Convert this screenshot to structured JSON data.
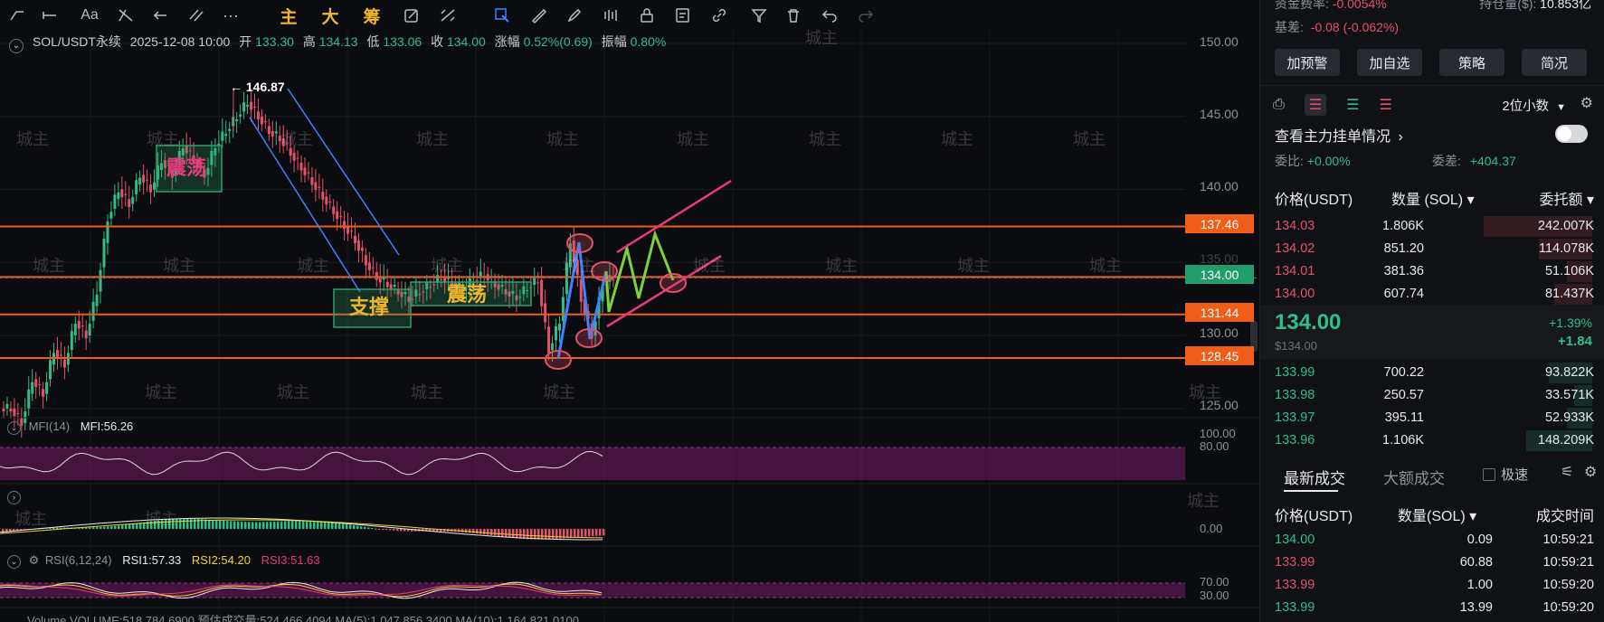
{
  "toolbar": {
    "highlights": [
      "主",
      "大",
      "筹"
    ]
  },
  "chart": {
    "symbol": "SOL/USDT永续",
    "datetime": "2025-12-08 10:00",
    "open_label": "开",
    "open": "133.30",
    "high_label": "高",
    "high": "134.13",
    "low_label": "低",
    "low": "133.06",
    "close_label": "收",
    "close": "134.00",
    "change_label": "涨幅",
    "change": "0.52%(0.69)",
    "amp_label": "振幅",
    "amp": "0.80%",
    "peak_label": "← 146.87",
    "box_text_1": "震荡",
    "box_text_2": "支撑",
    "box_text_3": "震荡",
    "watermark": "城主",
    "y_axis": [
      "150.00",
      "145.00",
      "140.00",
      "135.00",
      "130.00",
      "125.00"
    ],
    "levels": {
      "l1": "137.46",
      "current": "134.00",
      "l2": "131.44",
      "l3": "128.45"
    },
    "mfi_title": "MFI(14)",
    "mfi_value": "MFI:56.26",
    "mfi_axis": [
      "100.00",
      "80.00"
    ],
    "macd_axis": "0.00",
    "rsi_title": "RSI(6,12,24)",
    "rsi1": "RSI1:57.33",
    "rsi2": "RSI2:54.20",
    "rsi3": "RSI3:51.63",
    "rsi_axis": [
      "70.00",
      "30.00"
    ],
    "volume_line": "Volume  VOLUME:518,784.6900  预估成交量:524,466.4094  MA(5):1,047,856.3400  MA(10):1,164,821.0100"
  },
  "colors": {
    "up": "#2fbf86",
    "down": "#e4516a",
    "level": "#ef5d18",
    "box": "#2f9e6b",
    "highlight": "#f0b72c"
  },
  "panel": {
    "funding_label": "资金费率:",
    "funding": "-0.0054%",
    "oi_label": "持仓量($):",
    "oi": "10.853亿",
    "basis_label": "基差:",
    "basis": "-0.08 (-0.062%)",
    "buttons": [
      "加预警",
      "加自选",
      "策略",
      "简况"
    ],
    "decimals": "2位小数",
    "orders_title": "查看主力挂单情况",
    "ratio_label": "委比:",
    "ratio": "+0.00%",
    "diff_label": "委差:",
    "diff": "+404.37",
    "book_headers": [
      "价格(USDT)",
      "数量 (SOL)",
      "委托额"
    ],
    "asks": [
      {
        "price": "134.03",
        "qty": "1.806K",
        "amt": "242.007K",
        "depth": 0.86
      },
      {
        "price": "134.02",
        "qty": "851.20",
        "amt": "114.078K",
        "depth": 0.42
      },
      {
        "price": "134.01",
        "qty": "381.36",
        "amt": "51.106K",
        "depth": 0.2
      },
      {
        "price": "134.00",
        "qty": "607.74",
        "amt": "81.437K",
        "depth": 0.3
      }
    ],
    "last_price": "134.00",
    "last_usd": "$134.00",
    "last_pct": "+1.39%",
    "last_chg": "+1.84",
    "bids": [
      {
        "price": "133.99",
        "qty": "700.22",
        "amt": "93.822K",
        "depth": 0.34
      },
      {
        "price": "133.98",
        "qty": "250.57",
        "amt": "33.571K",
        "depth": 0.14
      },
      {
        "price": "133.97",
        "qty": "395.11",
        "amt": "52.933K",
        "depth": 0.2
      },
      {
        "price": "133.96",
        "qty": "1.106K",
        "amt": "148.209K",
        "depth": 0.52
      }
    ],
    "trades_tabs": [
      "最新成交",
      "大额成交"
    ],
    "fast_label": "极速",
    "trades_headers": [
      "价格(USDT)",
      "数量(SOL)",
      "成交时间"
    ],
    "trades": [
      {
        "price": "134.00",
        "qty": "0.09",
        "time": "10:59:21",
        "side": "buy"
      },
      {
        "price": "133.99",
        "qty": "60.88",
        "time": "10:59:21",
        "side": "sell"
      },
      {
        "price": "133.99",
        "qty": "1.00",
        "time": "10:59:20",
        "side": "sell"
      },
      {
        "price": "133.99",
        "qty": "13.99",
        "time": "10:59:20",
        "side": "buy"
      }
    ]
  }
}
